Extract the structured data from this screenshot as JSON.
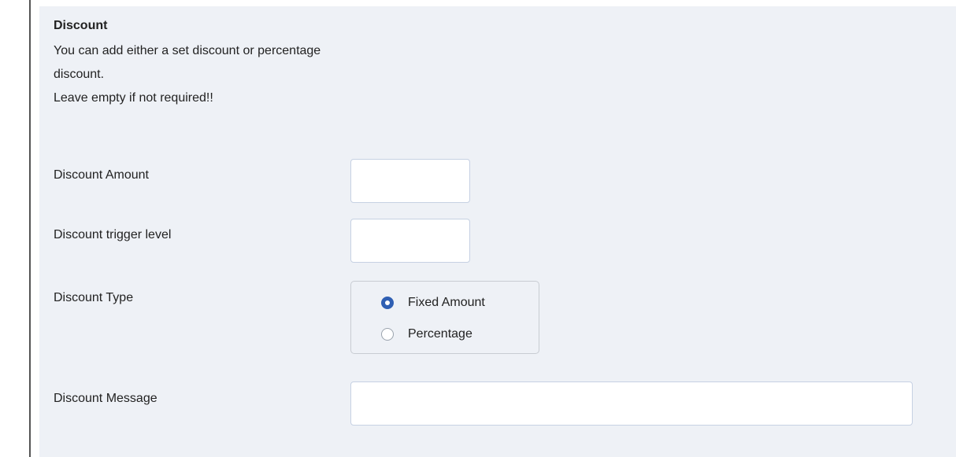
{
  "section": {
    "heading": "Discount",
    "description_lines": [
      "You can add either a set discount or percentage",
      "discount.",
      "Leave empty if not required!!"
    ]
  },
  "fields": {
    "discount_amount": {
      "label": "Discount Amount",
      "value": ""
    },
    "discount_trigger_level": {
      "label": "Discount trigger level",
      "value": ""
    },
    "discount_type": {
      "label": "Discount Type",
      "options": [
        {
          "label": "Fixed Amount",
          "checked": true
        },
        {
          "label": "Percentage",
          "checked": false
        }
      ]
    },
    "discount_message": {
      "label": "Discount Message",
      "value": ""
    }
  },
  "colors": {
    "panel_background": "#eef1f6",
    "input_border": "#c6d1e3",
    "radio_checked": "#2f5fb3"
  }
}
